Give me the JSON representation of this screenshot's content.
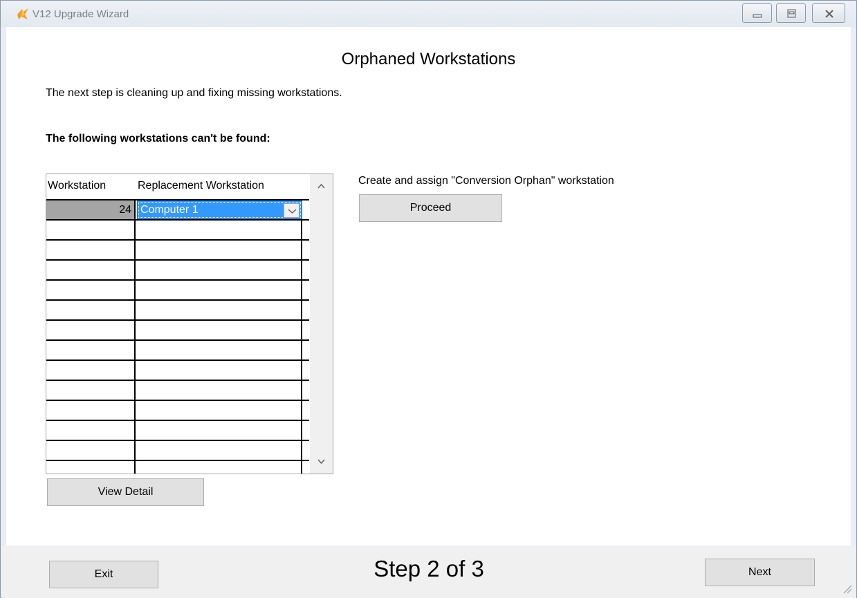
{
  "window": {
    "title": "V12 Upgrade Wizard",
    "icon": "app-logo-icon",
    "controls": [
      "minimize-icon",
      "maximize-icon",
      "close-icon"
    ]
  },
  "page": {
    "heading": "Orphaned Workstations",
    "intro": "The next step is cleaning up and fixing missing workstations.",
    "subheading": "The following workstations can't be found:"
  },
  "grid": {
    "columns": [
      "Workstation",
      "Replacement Workstation"
    ],
    "rows": [
      {
        "workstation": "24",
        "replacement": "Computer 1"
      }
    ],
    "empty_rows": 12
  },
  "actions": {
    "view_detail": "View Detail",
    "assign_label": "Create and assign \"Conversion Orphan\" workstation",
    "proceed": "Proceed"
  },
  "footer": {
    "exit": "Exit",
    "step": "Step 2 of 3",
    "next": "Next"
  },
  "colors": {
    "selection": "#3399ff",
    "selected_cell": "#a5a5a5",
    "button_face": "#e1e1e1",
    "footer_bg": "#f0f0f0"
  }
}
